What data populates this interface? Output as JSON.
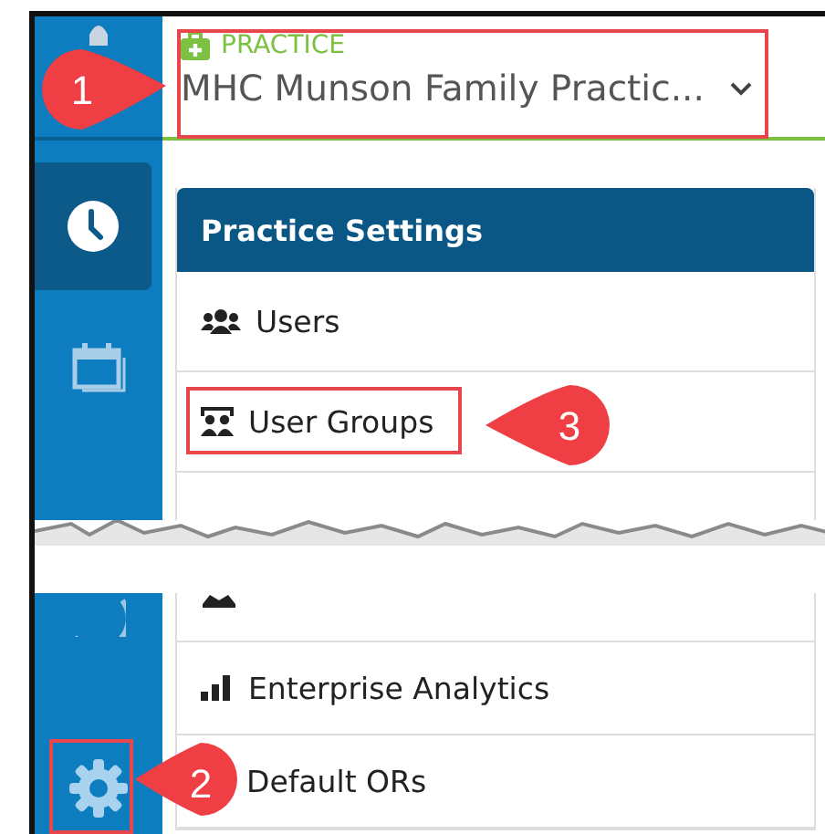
{
  "sidebar": {
    "top_items": [
      {
        "selected": false
      },
      {
        "selected": true
      },
      {
        "selected": false
      }
    ],
    "bottom_items": [
      {
        "selected": false
      },
      {
        "selected": false
      }
    ]
  },
  "practice_selector": {
    "label": "PRACTICE",
    "value": "MHC Munson Family Practic..."
  },
  "settings_panel": {
    "title": "Practice Settings",
    "items_top": [
      {
        "label": "Users"
      },
      {
        "label": "User Groups"
      }
    ],
    "items_bottom": [
      {
        "cut": true
      },
      {
        "label": "Enterprise Analytics"
      },
      {
        "label": "Default ORs"
      }
    ]
  },
  "callouts": [
    {
      "number": "1"
    },
    {
      "number": "3"
    },
    {
      "number": "2"
    }
  ]
}
